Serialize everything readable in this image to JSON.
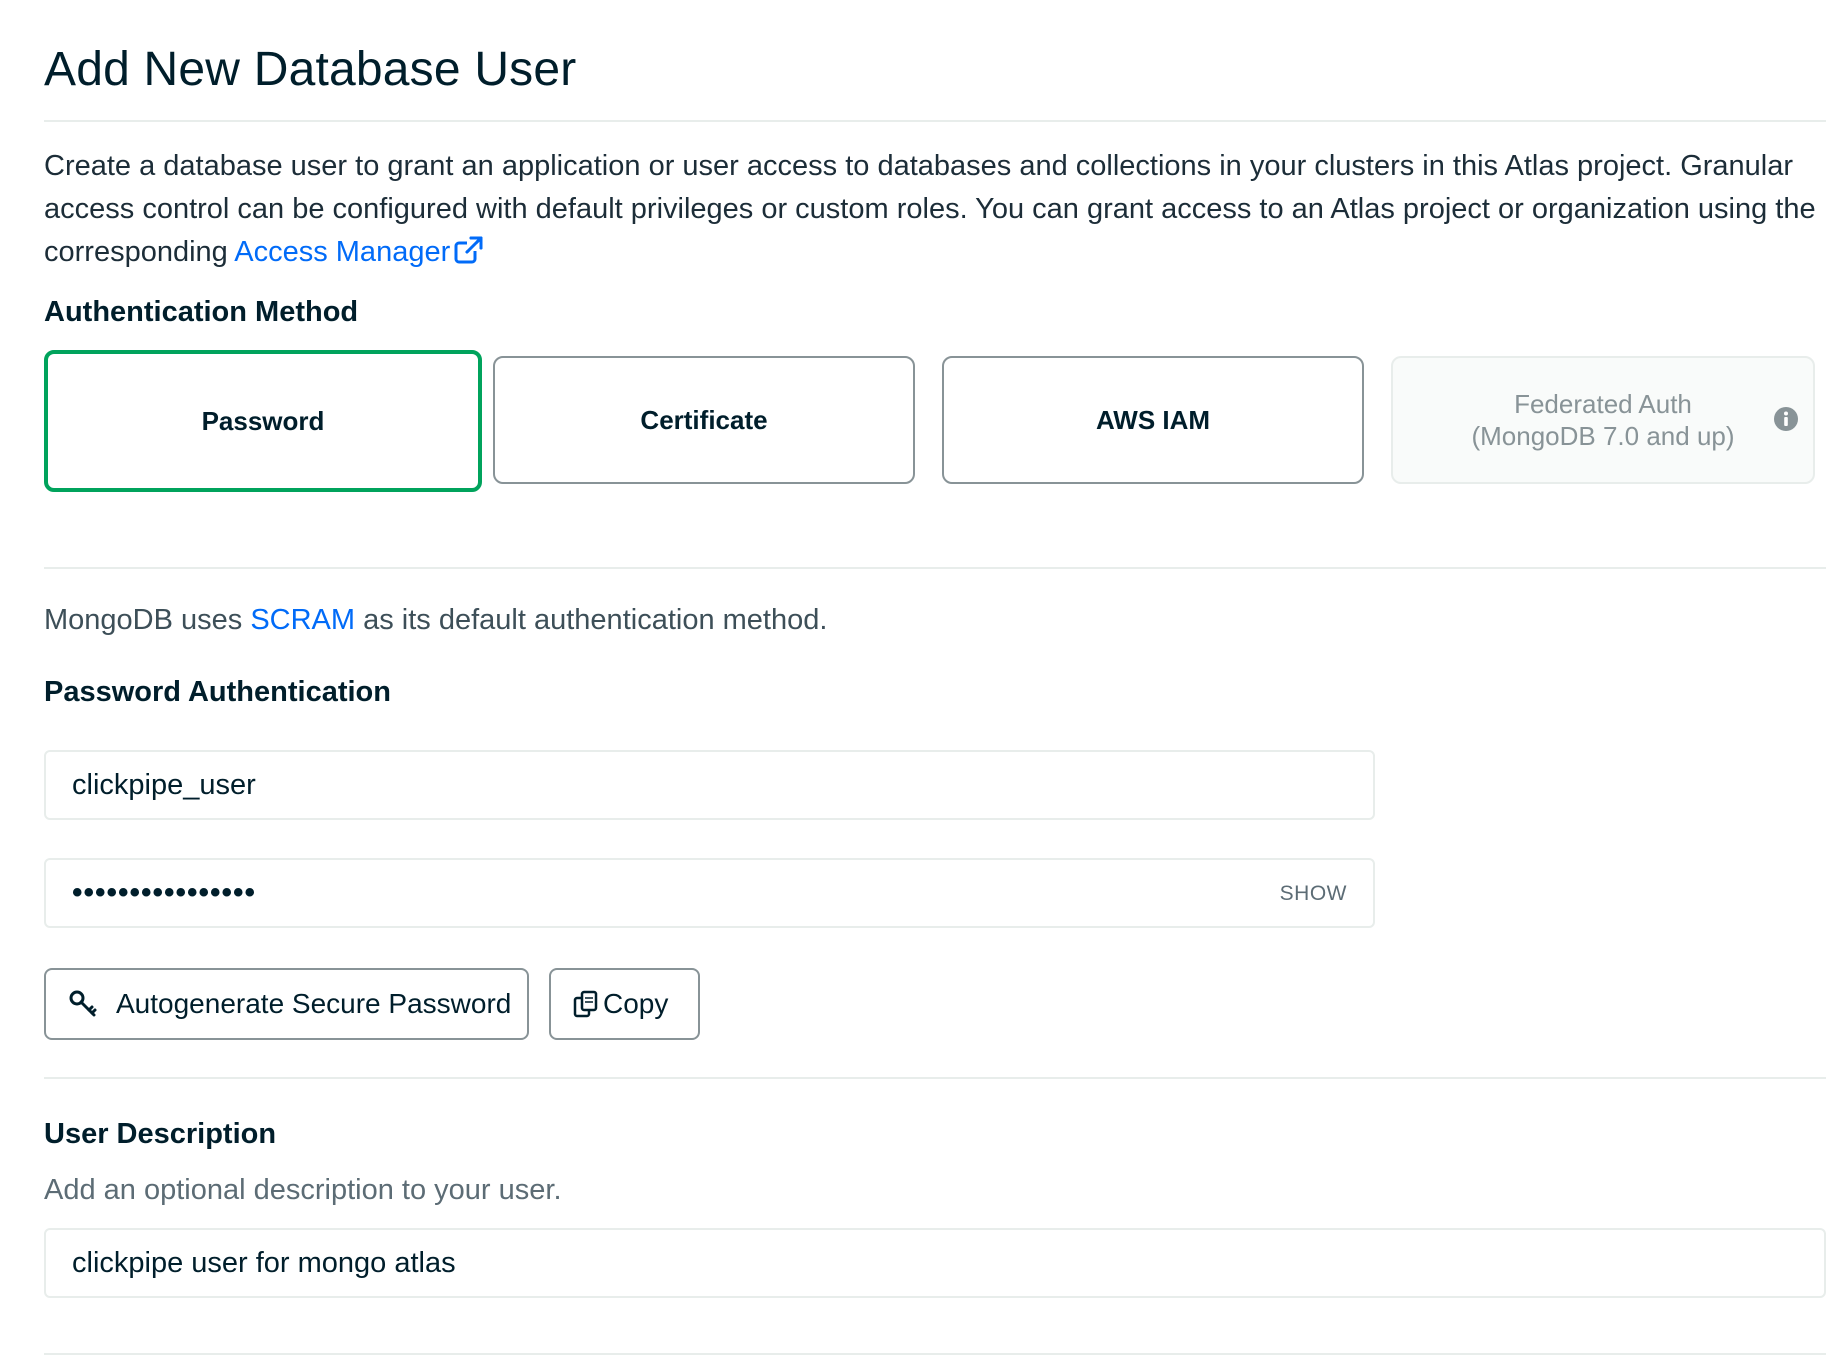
{
  "title": "Add New Database User",
  "intro": {
    "text": "Create a database user to grant an application or user access to databases and collections in your clusters in this Atlas project. Granular access control can be configured with default privileges or custom roles. You can grant access to an Atlas project or organization using the corresponding ",
    "link_label": "Access Manager"
  },
  "auth_method": {
    "label": "Authentication Method",
    "options": [
      {
        "label": "Password",
        "selected": true
      },
      {
        "label": "Certificate",
        "selected": false
      },
      {
        "label": "AWS IAM",
        "selected": false
      },
      {
        "label_line1": "Federated Auth",
        "label_line2": "(MongoDB 7.0 and up)",
        "disabled": true
      }
    ]
  },
  "scram_note": {
    "prefix": "MongoDB uses ",
    "link": "SCRAM",
    "suffix": " as its default authentication method."
  },
  "password_auth": {
    "label": "Password Authentication",
    "username_value": "clickpipe_user",
    "password_masked": "••••••••••••••••",
    "show_label": "SHOW",
    "autogenerate_label": "Autogenerate Secure Password",
    "copy_label": "Copy"
  },
  "user_description": {
    "label": "User Description",
    "help": "Add an optional description to your user.",
    "value": "clickpipe user for mongo atlas"
  },
  "colors": {
    "selected_border": "#00a35c",
    "link": "#016bf8",
    "text": "#001e2b"
  }
}
